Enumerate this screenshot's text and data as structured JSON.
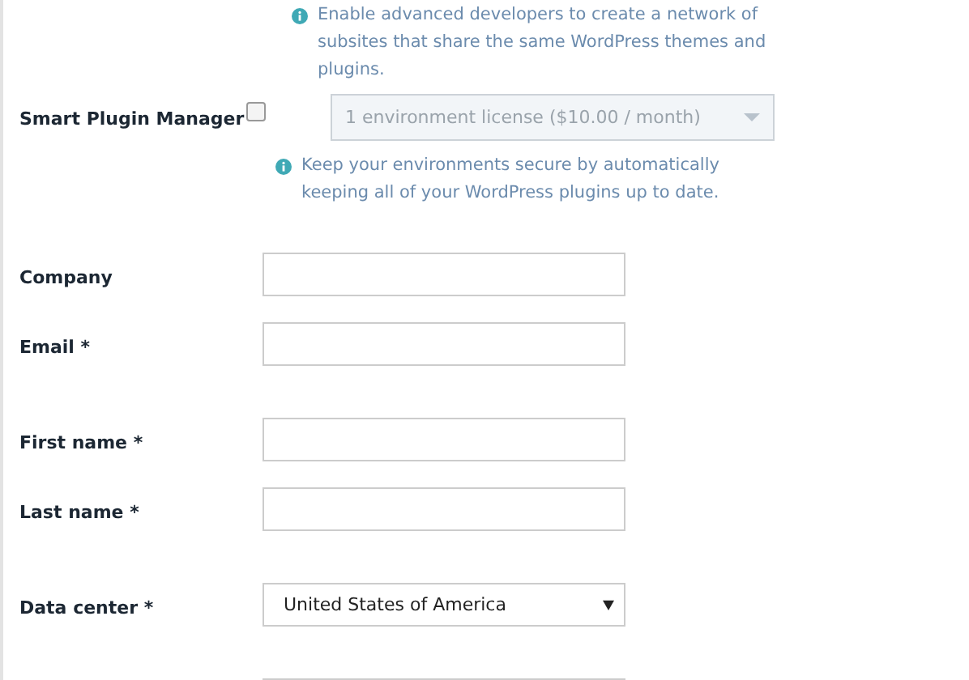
{
  "intro_help": {
    "lines": [
      "Enable advanced developers to create a network of",
      "subsites that share the same WordPress themes and",
      "plugins."
    ]
  },
  "addon": {
    "label": "Smart Plugin Manager",
    "checked": false,
    "select": {
      "value": "1 environment license ($10.00 / month)",
      "disabled": true
    },
    "help": [
      "Keep your environments secure by automatically",
      "keeping all of your WordPress plugins up to date."
    ]
  },
  "field_groups": [
    [
      {
        "kind": "text",
        "label": "Company"
      },
      {
        "kind": "text",
        "label": "Email *"
      }
    ],
    [
      {
        "kind": "text",
        "label": "First name *"
      },
      {
        "kind": "text",
        "label": "Last name *"
      }
    ],
    [
      {
        "kind": "select",
        "label": "Data center *",
        "value": "United States of America"
      }
    ],
    [
      {
        "kind": "text"
      }
    ]
  ]
}
